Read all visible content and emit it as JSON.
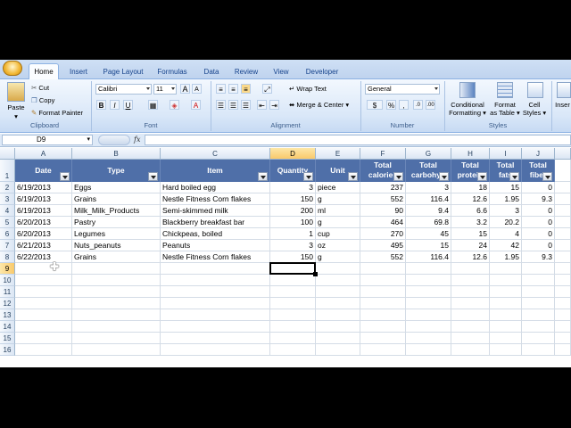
{
  "ribbon": {
    "tabs": [
      "Home",
      "Insert",
      "Page Layout",
      "Formulas",
      "Data",
      "Review",
      "View",
      "Developer"
    ],
    "clipboard": {
      "paste": "Paste",
      "cut": "Cut",
      "copy": "Copy",
      "format_painter": "Format Painter",
      "label": "Clipboard"
    },
    "font": {
      "name": "Calibri",
      "size": "11",
      "bold": "B",
      "italic": "I",
      "underline": "U",
      "grow": "A",
      "shrink": "A",
      "label": "Font"
    },
    "alignment": {
      "wrap": "Wrap Text",
      "merge": "Merge & Center",
      "label": "Alignment"
    },
    "number": {
      "format": "General",
      "currency": "$",
      "percent": "%",
      "comma": ",",
      "label": "Number"
    },
    "styles": {
      "conditional_1": "Conditional",
      "conditional_2": "Formatting",
      "format_table_1": "Format",
      "format_table_2": "as Table",
      "cell_styles_1": "Cell",
      "cell_styles_2": "Styles",
      "label": "Styles"
    },
    "cells": {
      "insert": "Inser"
    }
  },
  "formula_bar": {
    "name_box": "D9",
    "fx": "fx",
    "formula": ""
  },
  "sheet": {
    "columns": [
      "A",
      "B",
      "C",
      "D",
      "E",
      "F",
      "G",
      "H",
      "I",
      "J"
    ],
    "rows": [
      "1",
      "2",
      "3",
      "4",
      "5",
      "6",
      "7",
      "8",
      "9",
      "10",
      "11",
      "12",
      "13",
      "14",
      "15",
      "16"
    ],
    "headers": [
      [
        "Date"
      ],
      [
        "Type"
      ],
      [
        "Item"
      ],
      [
        "Quantity"
      ],
      [
        "Unit"
      ],
      [
        "Total",
        "calories"
      ],
      [
        "Total",
        "carbohyd"
      ],
      [
        "Total",
        "protein"
      ],
      [
        "Total",
        "fats"
      ],
      [
        "Total",
        "fiber"
      ]
    ],
    "data": [
      [
        "6/19/2013",
        "Eggs",
        "Hard boiled egg",
        "3",
        "piece",
        "237",
        "3",
        "18",
        "15",
        "0"
      ],
      [
        "6/19/2013",
        "Grains",
        "Nestle Fitness Corn flakes",
        "150",
        "g",
        "552",
        "116.4",
        "12.6",
        "1.95",
        "9.3"
      ],
      [
        "6/19/2013",
        "Milk_Milk_Products",
        "Semi-skimmed milk",
        "200",
        "ml",
        "90",
        "9.4",
        "6.6",
        "3",
        "0"
      ],
      [
        "6/20/2013",
        "Pastry",
        "Blackberry breakfast bar",
        "100",
        "g",
        "464",
        "69.8",
        "3.2",
        "20.2",
        "0"
      ],
      [
        "6/20/2013",
        "Legumes",
        "Chickpeas, boiled",
        "1",
        "cup",
        "270",
        "45",
        "15",
        "4",
        "0"
      ],
      [
        "6/21/2013",
        "Nuts_peanuts",
        "Peanuts",
        "3",
        "oz",
        "495",
        "15",
        "24",
        "42",
        "0"
      ],
      [
        "6/22/2013",
        "Grains",
        "Nestle Fitness Corn flakes",
        "150",
        "g",
        "552",
        "116.4",
        "12.6",
        "1.95",
        "9.3"
      ]
    ],
    "active_cell": "D9",
    "header_color": "#4f6fa8",
    "selection_color": "#f9c96b"
  }
}
